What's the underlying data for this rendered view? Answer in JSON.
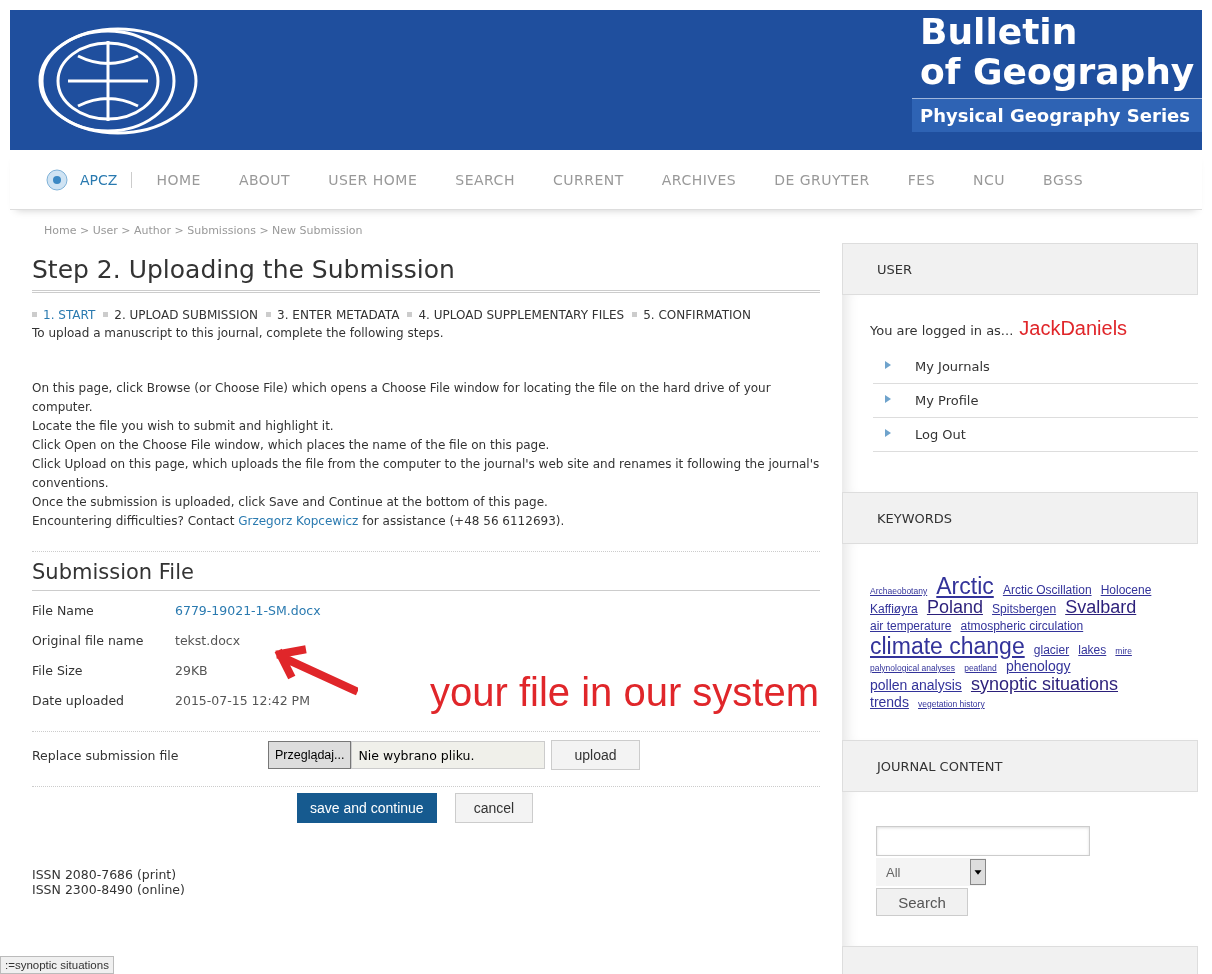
{
  "header": {
    "title_lines": [
      "Bulletin",
      "of Geography"
    ],
    "series": "Physical Geography Series"
  },
  "nav": {
    "brand": "APCZ",
    "items": [
      "HOME",
      "ABOUT",
      "USER HOME",
      "SEARCH",
      "CURRENT",
      "ARCHIVES",
      "DE GRUYTER",
      "FES",
      "NCU",
      "BGSS"
    ]
  },
  "breadcrumb": "Home > User > Author > Submissions > New Submission",
  "page_title": "Step 2. Uploading the Submission",
  "steps": [
    {
      "label": "1. START",
      "selected": true
    },
    {
      "label": "2. UPLOAD SUBMISSION",
      "selected": false
    },
    {
      "label": "3. ENTER METADATA",
      "selected": false
    },
    {
      "label": "4. UPLOAD SUPPLEMENTARY FILES",
      "selected": false
    },
    {
      "label": "5. CONFIRMATION",
      "selected": false
    }
  ],
  "intro": "To upload a manuscript to this journal, complete the following steps.",
  "instructions": [
    "On this page, click Browse (or Choose File) which opens a Choose File window for locating the file on the hard drive of your computer.",
    "Locate the file you wish to submit and highlight it.",
    "Click Open on the Choose File window, which places the name of the file on this page.",
    "Click Upload on this page, which uploads the file from the computer to the journal's web site and renames it following the journal's conventions.",
    "Once the submission is uploaded, click Save and Continue at the bottom of this page."
  ],
  "contact": {
    "before": "Encountering difficulties? Contact",
    "link": "Grzegorz Kopcewicz",
    "after": "for assistance (+48 56 6112693)."
  },
  "submission_file": {
    "title": "Submission File",
    "rows": [
      {
        "label": "File Name",
        "value": "6779-19021-1-SM.docx",
        "kind": "link"
      },
      {
        "label": "Original file name",
        "value": "tekst.docx",
        "kind": "text"
      },
      {
        "label": "File Size",
        "value": "29KB",
        "kind": "text"
      },
      {
        "label": "Date uploaded",
        "value": "2015-07-15 12:42 PM",
        "kind": "text"
      }
    ]
  },
  "replace": {
    "label": "Replace submission file",
    "browse": "Przeglądaj...",
    "file_status": "Nie wybrano pliku.",
    "upload": "upload"
  },
  "actions": {
    "save": "save and continue",
    "cancel": "cancel"
  },
  "annotation": {
    "text": "your file in our system"
  },
  "issn": [
    "ISSN 2080-7686 (print)",
    "ISSN 2300-8490 (online)"
  ],
  "status_bar": ":=synoptic situations",
  "sidebar": {
    "user": {
      "title": "USER",
      "logged_in": "You are logged in as...",
      "username": "JackDaniels",
      "links": [
        "My Journals",
        "My Profile",
        "Log Out"
      ]
    },
    "keywords": {
      "title": "KEYWORDS",
      "items": [
        {
          "text": "Archaeobotany",
          "kind": "xs"
        },
        {
          "text": "Arctic",
          "kind": "xl"
        },
        {
          "text": "Arctic Oscillation",
          "kind": "s"
        },
        {
          "text": "Holocene",
          "kind": "s"
        },
        {
          "text": "Kaffiøyra",
          "kind": "s"
        },
        {
          "text": "Poland",
          "kind": "l"
        },
        {
          "text": "Spitsbergen",
          "kind": "s"
        },
        {
          "text": "Svalbard",
          "kind": "l"
        },
        {
          "text": "air temperature",
          "kind": "s"
        },
        {
          "text": "atmospheric circulation",
          "kind": "s"
        },
        {
          "text": "climate change",
          "kind": "xl"
        },
        {
          "text": "glacier",
          "kind": "s"
        },
        {
          "text": "lakes",
          "kind": "s"
        },
        {
          "text": "mire",
          "kind": "xs"
        },
        {
          "text": "palynological analyses",
          "kind": "xs"
        },
        {
          "text": "peatland",
          "kind": "xs"
        },
        {
          "text": "phenology",
          "kind": "m"
        },
        {
          "text": "pollen analysis",
          "kind": "m"
        },
        {
          "text": "synoptic situations",
          "kind": "l"
        },
        {
          "text": "trends",
          "kind": "m"
        },
        {
          "text": "vegetation history",
          "kind": "xs"
        }
      ]
    },
    "journal_content": {
      "title": "JOURNAL CONTENT",
      "scope": "All",
      "button": "Search"
    }
  }
}
